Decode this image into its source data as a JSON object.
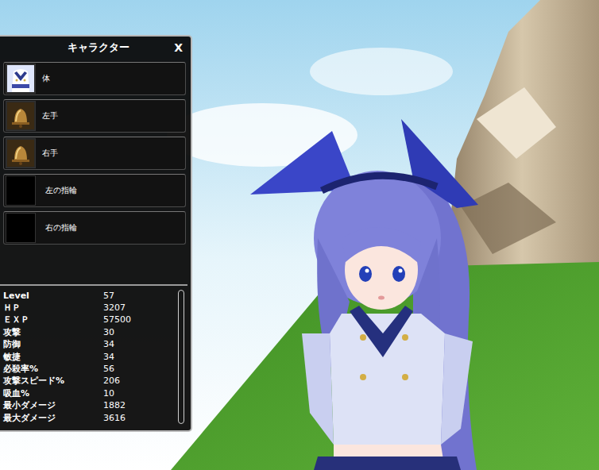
{
  "window": {
    "title": "キャラクター",
    "close": "X"
  },
  "slots": [
    {
      "label": "体",
      "equipped": true,
      "kind": "body"
    },
    {
      "label": "左手",
      "equipped": true,
      "kind": "bell"
    },
    {
      "label": "右手",
      "equipped": true,
      "kind": "bell"
    },
    {
      "label": "左の指輪",
      "equipped": false,
      "kind": "ring"
    },
    {
      "label": "右の指輪",
      "equipped": false,
      "kind": "ring"
    }
  ],
  "stats": [
    {
      "label": "Level",
      "value": "57"
    },
    {
      "label": "ＨＰ",
      "value": "3207"
    },
    {
      "label": "ＥＸＰ",
      "value": "57500"
    },
    {
      "label": "攻撃",
      "value": "30"
    },
    {
      "label": "防御",
      "value": "34"
    },
    {
      "label": "敏捷",
      "value": "34"
    },
    {
      "label": "必殺率%",
      "value": "56"
    },
    {
      "label": "攻撃スピード%",
      "value": "206"
    },
    {
      "label": "吸血%",
      "value": "10"
    },
    {
      "label": "最小ダメージ",
      "value": "1882"
    },
    {
      "label": "最大ダメージ",
      "value": "3616"
    }
  ]
}
